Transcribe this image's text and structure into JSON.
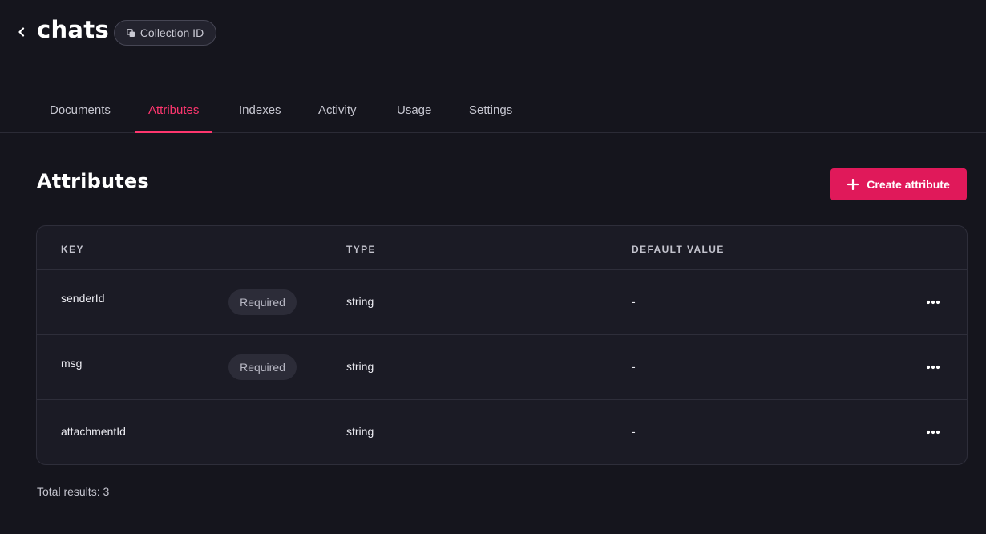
{
  "header": {
    "title": "chats",
    "collection_id_label": "Collection ID"
  },
  "tabs": [
    {
      "label": "Documents",
      "active": false
    },
    {
      "label": "Attributes",
      "active": true
    },
    {
      "label": "Indexes",
      "active": false
    },
    {
      "label": "Activity",
      "active": false
    },
    {
      "label": "Usage",
      "active": false
    },
    {
      "label": "Settings",
      "active": false
    }
  ],
  "section": {
    "title": "Attributes",
    "create_button_label": "Create attribute"
  },
  "table": {
    "columns": [
      "KEY",
      "TYPE",
      "DEFAULT VALUE"
    ],
    "rows": [
      {
        "key": "senderId",
        "badge": "Required",
        "type": "string",
        "default": "-"
      },
      {
        "key": "msg",
        "badge": "Required",
        "type": "string",
        "default": "-"
      },
      {
        "key": "attachmentId",
        "badge": "",
        "type": "string",
        "default": "-"
      }
    ]
  },
  "footer": {
    "total_results": "Total results: 3"
  },
  "colors": {
    "accent": "#fd366e",
    "button": "#e0195a",
    "background": "#15151d",
    "table_background": "#1b1b25"
  },
  "icons": {
    "back": "chevron-left-icon",
    "collection_id": "copy-icon",
    "create": "plus-icon",
    "row_menu": "more-horizontal-icon"
  }
}
